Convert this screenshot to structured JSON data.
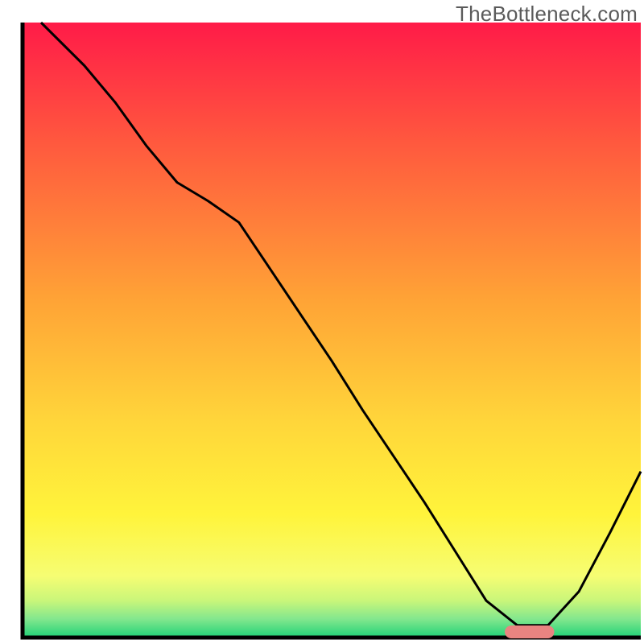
{
  "watermark": "TheBottleneck.com",
  "chart_data": {
    "type": "line",
    "title": "",
    "xlabel": "",
    "ylabel": "",
    "xlim": [
      0,
      100
    ],
    "ylim": [
      0,
      100
    ],
    "x": [
      3,
      10,
      15,
      20,
      25,
      30,
      35,
      40,
      45,
      50,
      55,
      60,
      65,
      70,
      75,
      80,
      85,
      90,
      95,
      100
    ],
    "values": [
      100,
      93,
      87,
      80,
      74,
      71,
      67.5,
      60,
      52.5,
      45,
      37,
      29.5,
      22,
      14,
      6,
      2,
      2,
      7.5,
      17,
      27
    ],
    "marker": {
      "x_start": 78,
      "x_end": 86,
      "color": "#e88481"
    },
    "gradient_stops": [
      {
        "offset": 0.0,
        "color": "#ff1b48"
      },
      {
        "offset": 0.2,
        "color": "#ff5a3e"
      },
      {
        "offset": 0.45,
        "color": "#ffa336"
      },
      {
        "offset": 0.65,
        "color": "#ffd63a"
      },
      {
        "offset": 0.8,
        "color": "#fff43b"
      },
      {
        "offset": 0.9,
        "color": "#f6fd73"
      },
      {
        "offset": 0.94,
        "color": "#c9f67a"
      },
      {
        "offset": 0.97,
        "color": "#82e78e"
      },
      {
        "offset": 1.0,
        "color": "#1fd176"
      }
    ],
    "axis_color": "#000000",
    "line_color": "#000000"
  }
}
